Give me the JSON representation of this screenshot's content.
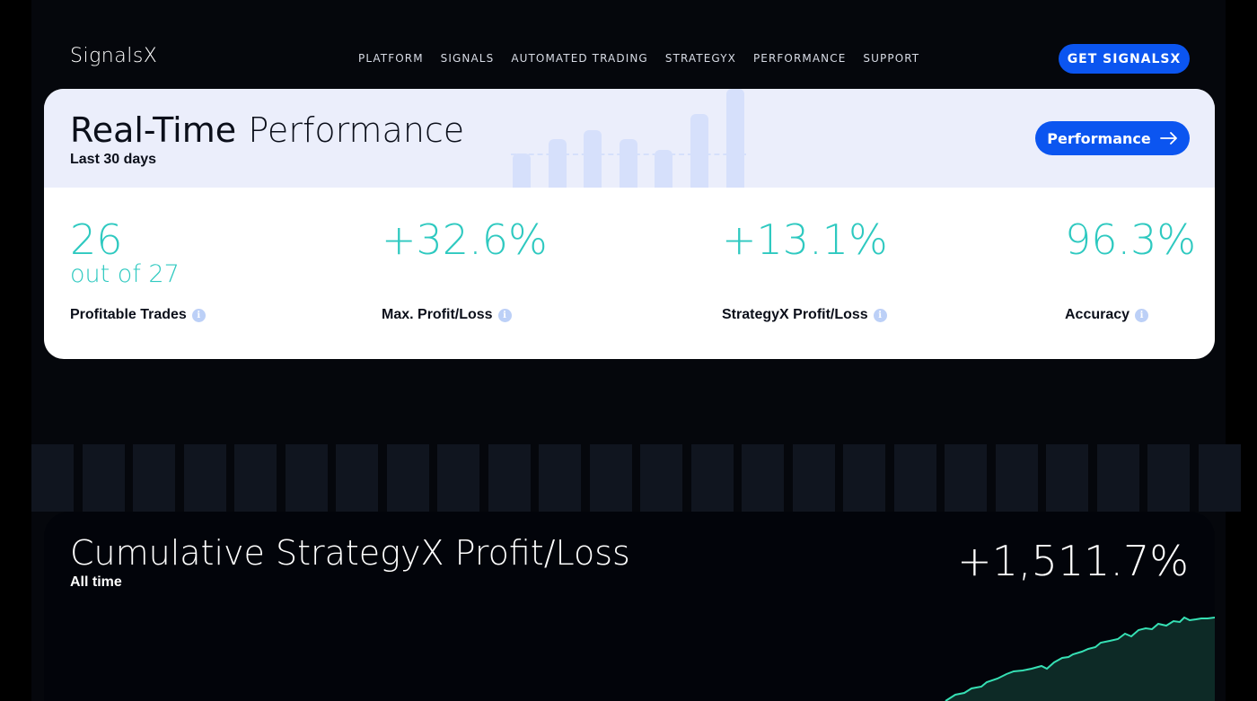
{
  "brand": {
    "logo": "SignalsX",
    "accent": "#0b55f0",
    "stat_color": "#2ec9c0"
  },
  "nav": {
    "items": [
      {
        "label": "PLATFORM"
      },
      {
        "label": "SIGNALS"
      },
      {
        "label": "AUTOMATED TRADING"
      },
      {
        "label": "STRATEGYX"
      },
      {
        "label": "PERFORMANCE"
      },
      {
        "label": "SUPPORT"
      }
    ],
    "cta": "GET SIGNALSX"
  },
  "performance": {
    "title_bold": "Real-Time",
    "title_light": "Performance",
    "subtitle": "Last 30 days",
    "button_label": "Performance",
    "button_icon": "arrow-right-icon",
    "stats": [
      {
        "value": "26",
        "sub": "out of 27",
        "label": "Profitable Trades"
      },
      {
        "value": "+32.6%",
        "label": "Max. Profit/Loss"
      },
      {
        "value": "+13.1%",
        "label": "StrategyX Profit/Loss"
      },
      {
        "value": "96.3%",
        "label": "Accuracy"
      }
    ],
    "info_icon": "info-icon"
  },
  "cumulative": {
    "title": "Cumulative StrategyX Profit/Loss",
    "subtitle": "All time",
    "value": "+1,511.7%",
    "line_color": "#36e0b4"
  }
}
